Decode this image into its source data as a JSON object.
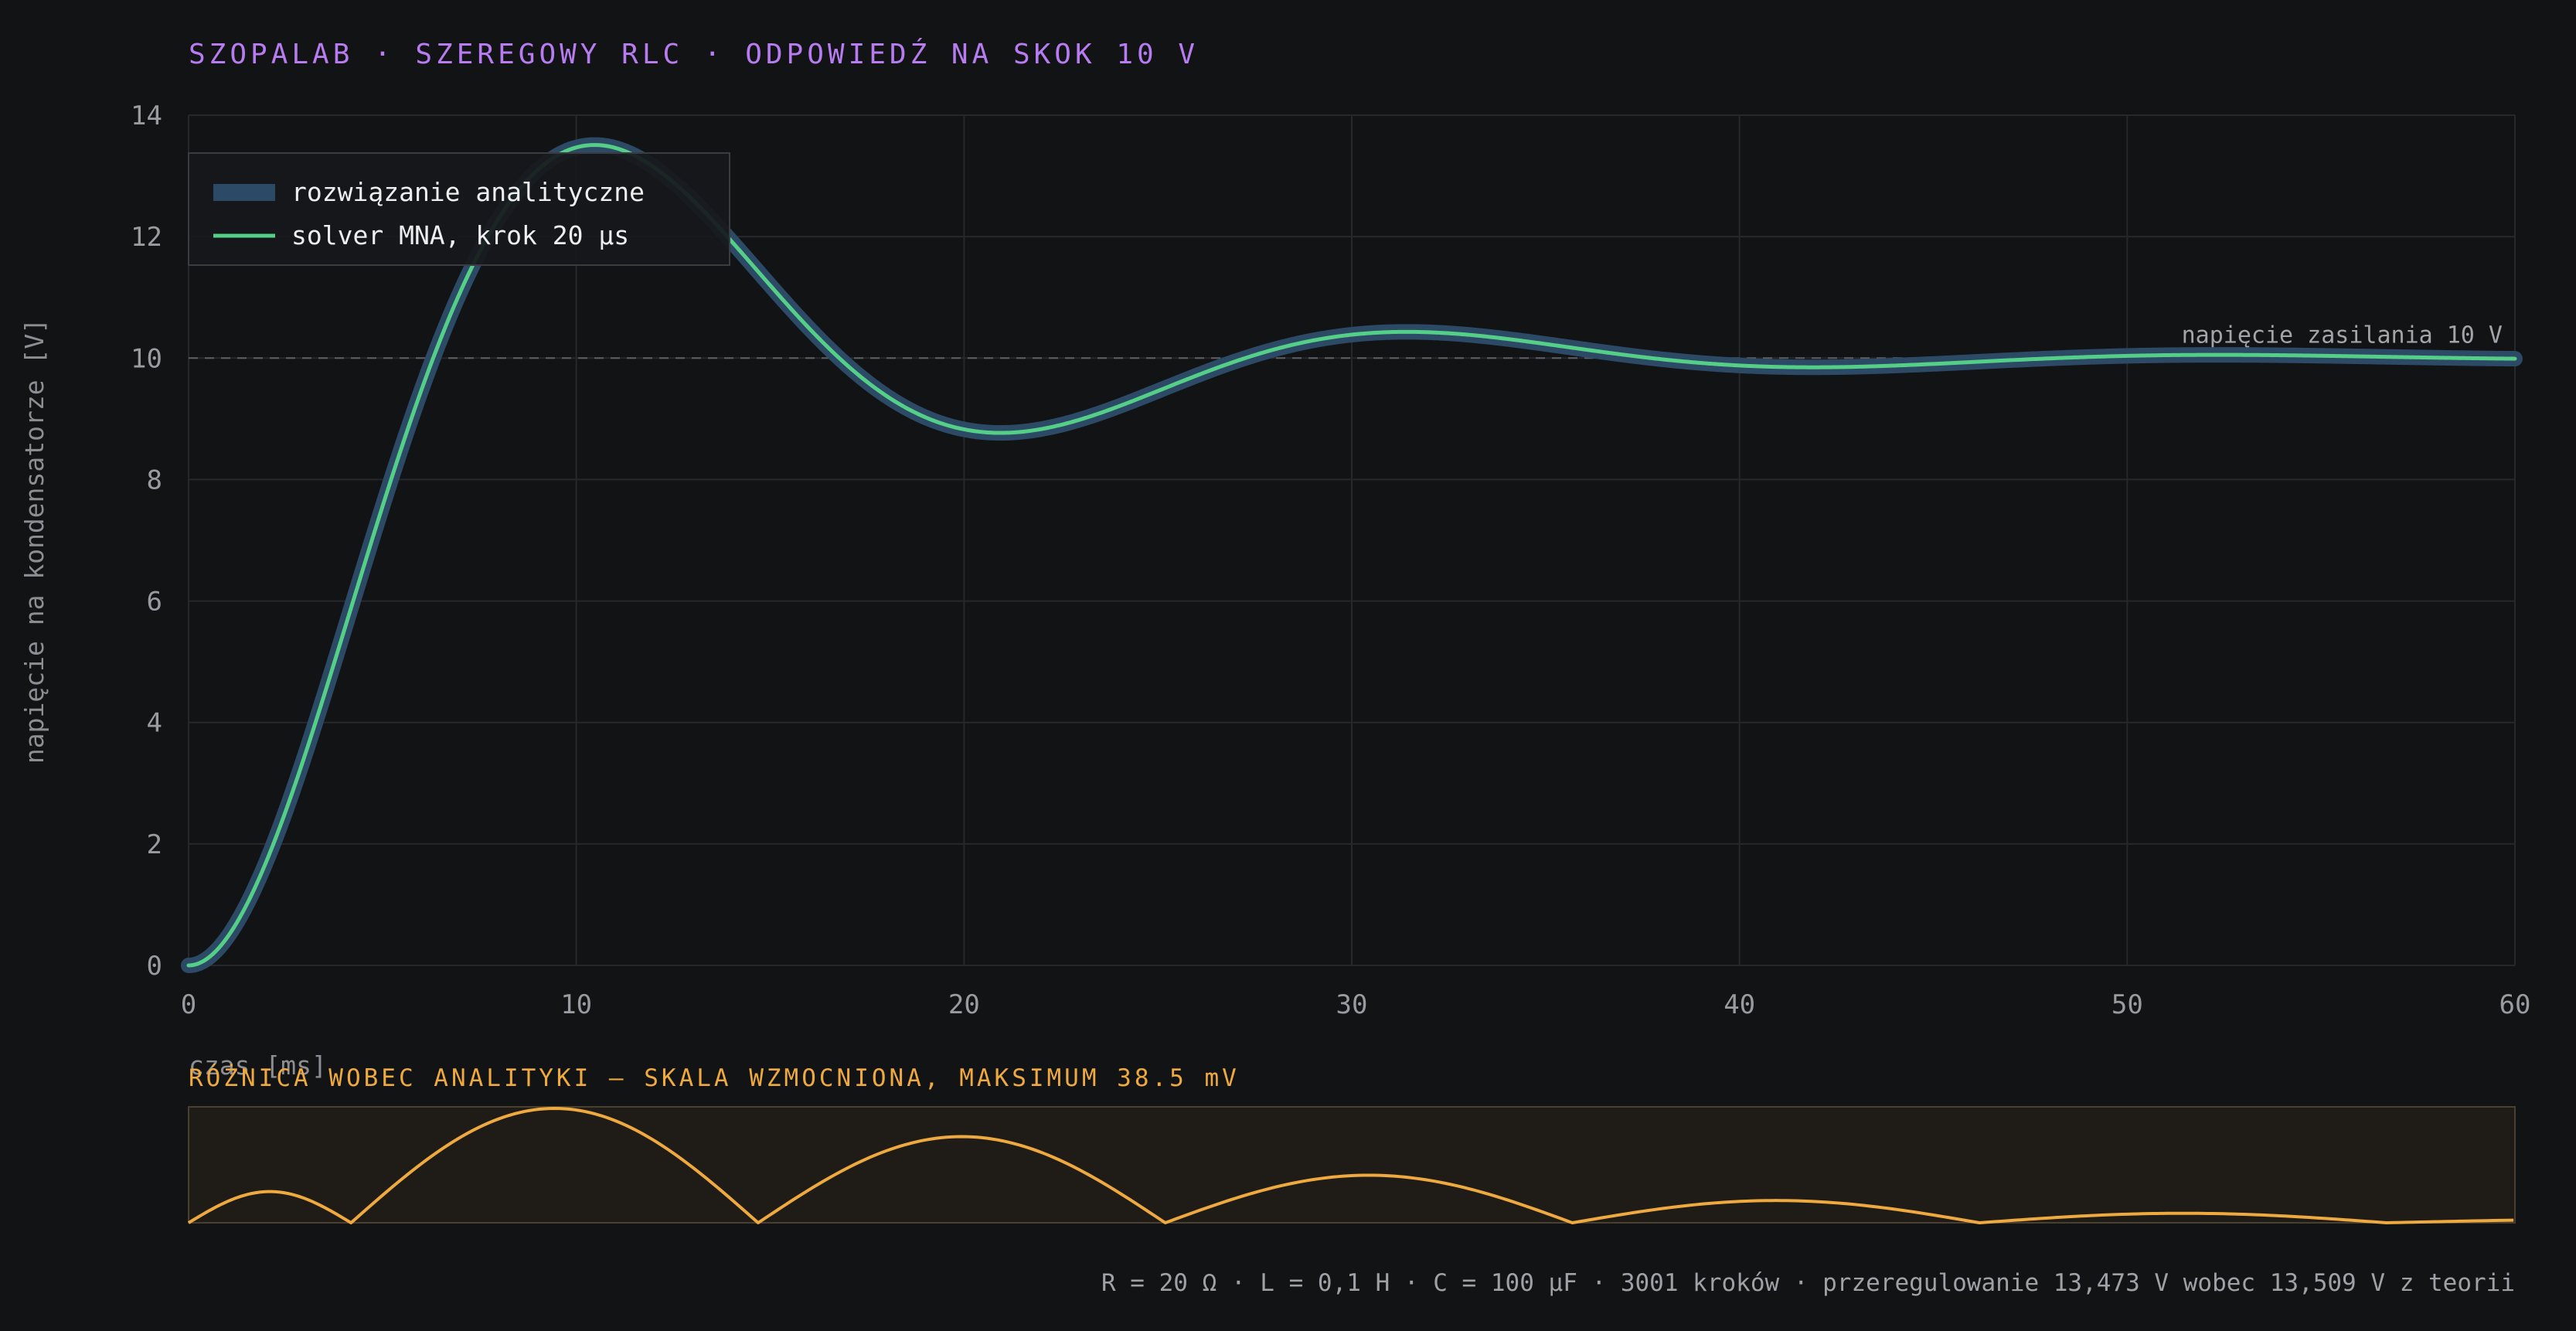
{
  "title": "SZOPALAB · SZEREGOWY RLC · ODPOWIEDŹ NA SKOK 10 V",
  "colors": {
    "background": "#121315",
    "title": "#b77cf0",
    "analytic": "#2c4a66",
    "solver": "#55cf87",
    "error": "#eea93f",
    "grid": "#26282c"
  },
  "chart_data": [
    {
      "type": "line",
      "xlabel": "czas [ms]",
      "ylabel": "napięcie na kondensatorze [V]",
      "xlim": [
        0,
        60
      ],
      "ylim": [
        0,
        14
      ],
      "x_ticks": [
        "0",
        "10",
        "20",
        "30",
        "40",
        "50",
        "60"
      ],
      "y_ticks": [
        "0",
        "2",
        "4",
        "6",
        "8",
        "10",
        "12",
        "14"
      ],
      "grid": true,
      "legend_position": "top-left",
      "reference_line": {
        "y": 10,
        "label": "napięcie zasilania 10 V"
      },
      "circuit": {
        "R": 20,
        "L": 0.1,
        "C": 0.0001,
        "V": 10
      },
      "series": [
        {
          "name": "rozwiązanie analityczne",
          "style": "wide-band",
          "color": "#2c4a66"
        },
        {
          "name": "solver MNA, krok 20 µs",
          "style": "line",
          "color": "#55cf87"
        }
      ],
      "sample_points": [
        {
          "x": 0,
          "y": 0
        },
        {
          "x": 2,
          "y": 1.85
        },
        {
          "x": 4,
          "y": 5.98
        },
        {
          "x": 6,
          "y": 9.9
        },
        {
          "x": 8,
          "y": 12.52
        },
        {
          "x": 10.5,
          "y": 13.51
        },
        {
          "x": 13,
          "y": 12.7
        },
        {
          "x": 16,
          "y": 10.6
        },
        {
          "x": 18,
          "y": 9.44
        },
        {
          "x": 21,
          "y": 8.8
        },
        {
          "x": 25,
          "y": 9.39
        },
        {
          "x": 28,
          "y": 10.12
        },
        {
          "x": 31.5,
          "y": 10.39
        },
        {
          "x": 36,
          "y": 10.12
        },
        {
          "x": 42,
          "y": 9.86
        },
        {
          "x": 52.5,
          "y": 10.05
        },
        {
          "x": 60,
          "y": 9.98
        }
      ]
    },
    {
      "type": "area",
      "title": "RÓŻNICA WOBEC ANALITYKI — SKALA WZMOCNIONA, MAKSIMUM 38.5 mV",
      "xlim": [
        0,
        60
      ],
      "max_mV": 38.5,
      "zeros_ms": [
        0,
        4.19,
        14.69,
        25.19,
        35.69,
        46.19,
        56.69
      ],
      "peaks": [
        {
          "x": 2,
          "y_mV": 10.5
        },
        {
          "x": 9.6,
          "y_mV": 38.5
        },
        {
          "x": 19.3,
          "y_mV": 29.0
        },
        {
          "x": 29.6,
          "y_mV": 16.0
        },
        {
          "x": 40.0,
          "y_mV": 7.5
        },
        {
          "x": 50.5,
          "y_mV": 3.2
        },
        {
          "x": 59.0,
          "y_mV": 1.3
        }
      ]
    }
  ],
  "footer": "R = 20 Ω · L = 0,1 H · C = 100 µF · 3001 kroków · przeregulowanie 13,473 V wobec 13,509 V z teorii"
}
